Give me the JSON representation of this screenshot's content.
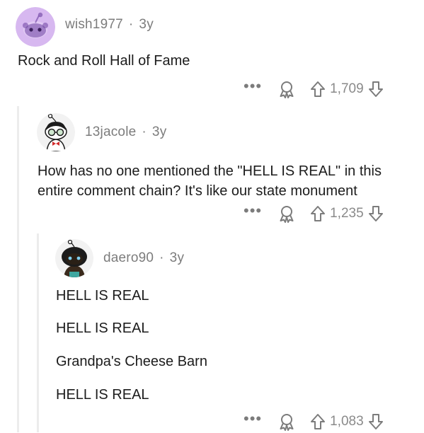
{
  "comments": [
    {
      "username": "wish1977",
      "age": "3y",
      "separator": "·",
      "body": "Rock and Roll Hall of Fame",
      "more": "•••",
      "score": "1,709"
    },
    {
      "username": "13jacole",
      "age": "3y",
      "separator": "·",
      "body": "How has no one mentioned the \"HELL IS REAL\" in this entire comment chain? It's like our state monument",
      "more": "•••",
      "score": "1,235"
    },
    {
      "username": "daero90",
      "age": "3y",
      "separator": "·",
      "lines": [
        "HELL IS REAL",
        "HELL IS REAL",
        "Grandpa's Cheese Barn",
        "HELL IS REAL"
      ],
      "more": "•••",
      "score": "1,083"
    }
  ],
  "icons": {
    "award": "award-icon",
    "upvote": "upvote-arrow-icon",
    "downvote": "downvote-arrow-icon",
    "more": "more-options-icon"
  },
  "colors": {
    "text": "#1c1c1c",
    "meta": "#7c7c7c",
    "thread_line": "#ececec",
    "avatar_purple": "#c6a4e8"
  }
}
